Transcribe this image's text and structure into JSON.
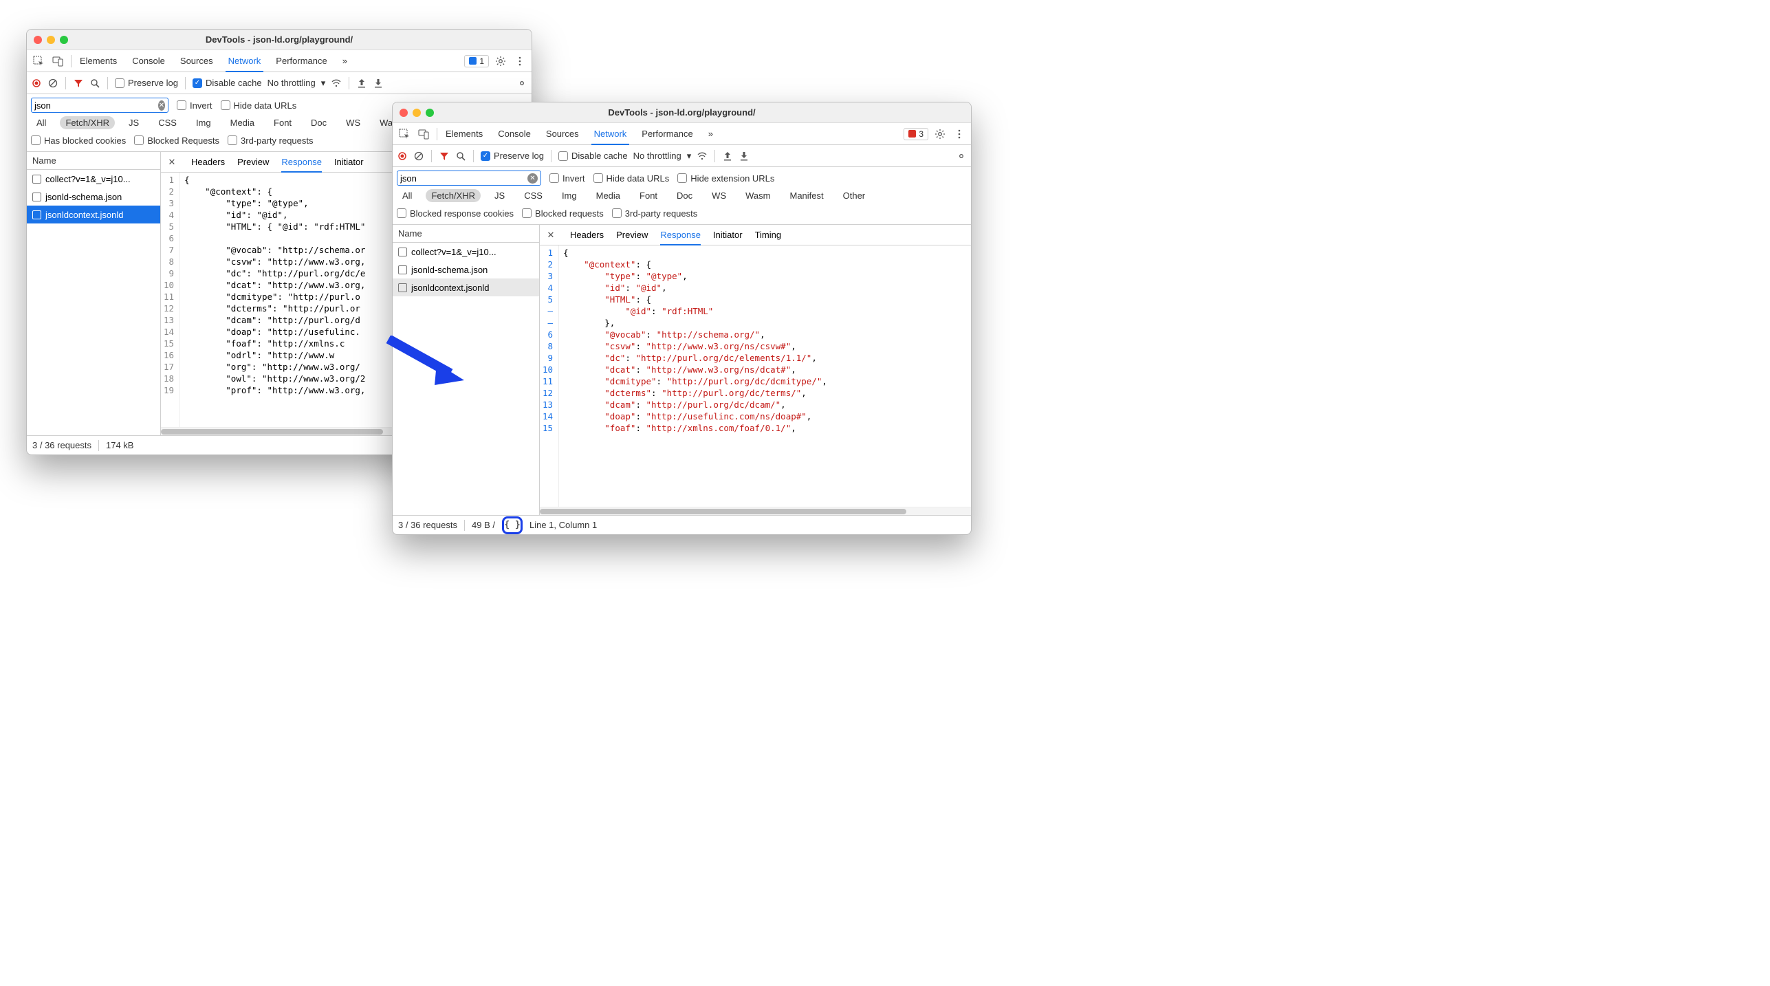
{
  "title": "DevTools - json-ld.org/playground/",
  "tabs": {
    "main": [
      "Elements",
      "Console",
      "Sources",
      "Network",
      "Performance"
    ],
    "active": "Network",
    "more": "»"
  },
  "issues": {
    "w1_label": "1",
    "w2_label": "3"
  },
  "toolbar": {
    "preserve_log": "Preserve log",
    "disable_cache": "Disable cache",
    "throttling": "No throttling"
  },
  "filter": {
    "value": "json",
    "invert": "Invert",
    "hide_data_urls": "Hide data URLs",
    "hide_ext_urls": "Hide extension URLs",
    "types": [
      "All",
      "Fetch/XHR",
      "JS",
      "CSS",
      "Img",
      "Media",
      "Font",
      "Doc",
      "WS",
      "Wasm",
      "Manifest"
    ],
    "types_w2_extra": "Other",
    "active_type": "Fetch/XHR",
    "row3_w1": [
      "Has blocked cookies",
      "Blocked Requests",
      "3rd-party requests"
    ],
    "row3_w2": [
      "Blocked response cookies",
      "Blocked requests",
      "3rd-party requests"
    ]
  },
  "name_header": "Name",
  "requests": [
    {
      "label": "collect?v=1&_v=j10..."
    },
    {
      "label": "jsonld-schema.json"
    },
    {
      "label": "jsonldcontext.jsonld"
    }
  ],
  "detail_tabs": [
    "Headers",
    "Preview",
    "Response",
    "Initiator",
    "Timing"
  ],
  "detail_active": "Response",
  "status": {
    "requests": "3 / 36 requests",
    "w1_size": "174 kB",
    "w2_size": "49 B /",
    "cursor": "Line 1, Column 1"
  },
  "code_w1": {
    "lines": [
      1,
      2,
      3,
      4,
      5,
      6,
      7,
      8,
      9,
      10,
      11,
      12,
      13,
      14,
      15,
      16,
      17,
      18,
      19
    ],
    "text": "{\n    \"@context\": {\n        \"type\": \"@type\",\n        \"id\": \"@id\",\n        \"HTML\": { \"@id\": \"rdf:HTML\"\n\n        \"@vocab\": \"http://schema.or\n        \"csvw\": \"http://www.w3.org,\n        \"dc\": \"http://purl.org/dc/e\n        \"dcat\": \"http://www.w3.org,\n        \"dcmitype\": \"http://purl.o\n        \"dcterms\": \"http://purl.or\n        \"dcam\": \"http://purl.org/d\n        \"doap\": \"http://usefulinc.\n        \"foaf\": \"http://xmlns.c\n        \"odrl\": \"http://www.w\n        \"org\": \"http://www.w3.org/\n        \"owl\": \"http://www.w3.org/2\n        \"prof\": \"http://www.w3.org,"
  },
  "code_w2": {
    "lines": [
      "1",
      "2",
      "3",
      "4",
      "5",
      "–",
      "–",
      "6",
      "8",
      "9",
      "10",
      "11",
      "12",
      "13",
      "14",
      "15"
    ],
    "rows": [
      {
        "text": "{",
        "indent": 0
      },
      {
        "key": "@context",
        "after": ": {",
        "indent": 1
      },
      {
        "key": "type",
        "val": "@type",
        "after": ",",
        "indent": 2
      },
      {
        "key": "id",
        "val": "@id",
        "after": ",",
        "indent": 2
      },
      {
        "key": "HTML",
        "after": ": {",
        "indent": 2
      },
      {
        "key": "@id",
        "val": "rdf:HTML",
        "indent": 3
      },
      {
        "text": "},",
        "indent": 2
      },
      {
        "key": "@vocab",
        "val": "http://schema.org/",
        "after": ",",
        "indent": 2
      },
      {
        "key": "csvw",
        "val": "http://www.w3.org/ns/csvw#",
        "after": ",",
        "indent": 2
      },
      {
        "key": "dc",
        "val": "http://purl.org/dc/elements/1.1/",
        "after": ",",
        "indent": 2
      },
      {
        "key": "dcat",
        "val": "http://www.w3.org/ns/dcat#",
        "after": ",",
        "indent": 2
      },
      {
        "key": "dcmitype",
        "val": "http://purl.org/dc/dcmitype/",
        "after": ",",
        "indent": 2
      },
      {
        "key": "dcterms",
        "val": "http://purl.org/dc/terms/",
        "after": ",",
        "indent": 2
      },
      {
        "key": "dcam",
        "val": "http://purl.org/dc/dcam/",
        "after": ",",
        "indent": 2
      },
      {
        "key": "doap",
        "val": "http://usefulinc.com/ns/doap#",
        "after": ",",
        "indent": 2
      },
      {
        "key": "foaf",
        "val": "http://xmlns.com/foaf/0.1/",
        "after": ",",
        "indent": 2
      }
    ]
  }
}
